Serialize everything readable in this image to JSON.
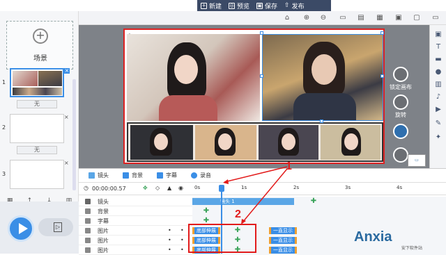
{
  "topbar": {
    "items": [
      {
        "label": "新建",
        "icon": "new-file-icon"
      },
      {
        "label": "预览",
        "icon": "preview-icon"
      },
      {
        "label": "保存",
        "icon": "save-icon"
      },
      {
        "label": "发布",
        "icon": "publish-icon"
      }
    ]
  },
  "left": {
    "add_scene_label": "场景",
    "scenes": [
      {
        "num": "1"
      },
      {
        "num": "2"
      },
      {
        "num": "3"
      }
    ],
    "transitions": [
      "无",
      "无"
    ]
  },
  "right_float": {
    "lock_label": "锁定画布",
    "rotate_label": "旋转"
  },
  "canvas": {
    "index_label": "1"
  },
  "timeline": {
    "tabs": [
      {
        "label": "镜头",
        "color": "#5aa6e6"
      },
      {
        "label": "背景",
        "color": "#3a8ee6"
      },
      {
        "label": "字幕",
        "color": "#3a8ee6"
      },
      {
        "label": "录音",
        "color": "#3a8ee6"
      }
    ],
    "timecode": "00:00:00.57",
    "ticks": [
      "0s",
      "1s",
      "2s",
      "3s",
      "4s"
    ],
    "rows": [
      {
        "label": "镜头",
        "clip": "镜头 1"
      },
      {
        "label": "背景"
      },
      {
        "label": "字幕"
      },
      {
        "label": "图片",
        "enter": "底部伸展",
        "exit": "一直显示"
      },
      {
        "label": "图片",
        "enter": "底部伸展",
        "exit": "一直显示"
      },
      {
        "label": "图片",
        "enter": "底部伸展",
        "exit": "一直显示"
      }
    ]
  },
  "annotations": {
    "one": "1",
    "two": "2"
  },
  "watermark": {
    "main": "Anxia",
    "sub": "安下软件站"
  },
  "colors": {
    "accent": "#3a8ee6",
    "annotation_red": "#e21b1b",
    "topbar": "#3b4a66"
  }
}
